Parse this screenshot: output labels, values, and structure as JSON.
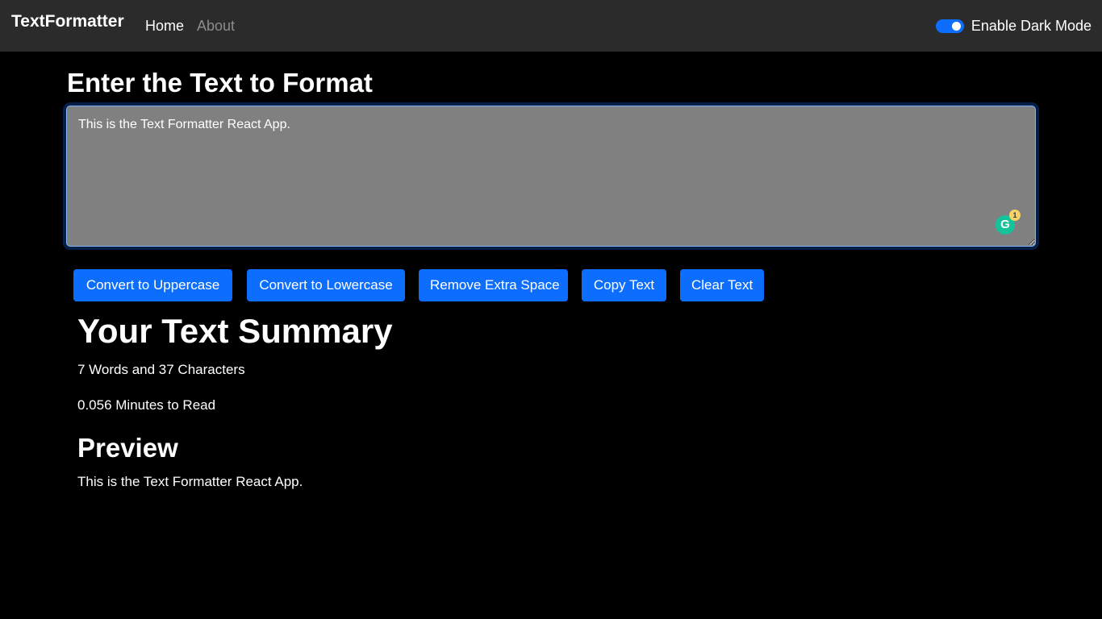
{
  "navbar": {
    "brand": "TextFormatter",
    "links": [
      "Home",
      "About"
    ],
    "dark_mode_label": "Enable Dark Mode",
    "dark_mode_enabled": true
  },
  "main": {
    "heading": "Enter the Text to Format",
    "textarea_value": "This is the Text Formatter React App.",
    "grammarly_badge_count": "1",
    "buttons": {
      "uppercase": "Convert to Uppercase",
      "lowercase": "Convert to Lowercase",
      "remove_space": "Remove Extra Space",
      "copy": "Copy Text",
      "clear": "Clear Text"
    }
  },
  "summary": {
    "title": "Your Text Summary",
    "words_line": "7 Words and 37 Characters",
    "read_line": "0.056 Minutes to Read"
  },
  "preview": {
    "title": "Preview",
    "text": "This is the Text Formatter React App."
  },
  "colors": {
    "navbar_bg": "#2b2b2b",
    "page_bg": "#000000",
    "textarea_bg": "#808080",
    "button": "#0d6efd",
    "inactive_link": "#8c8c8c"
  }
}
